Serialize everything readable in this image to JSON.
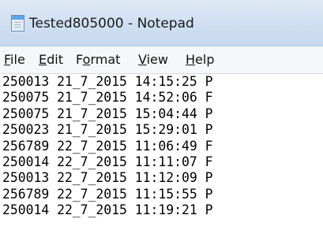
{
  "window": {
    "title": "Tested805000 - Notepad",
    "icon": "notepad-icon"
  },
  "menu": [
    {
      "prefix": "",
      "mnemonic": "F",
      "rest": "ile"
    },
    {
      "prefix": "",
      "mnemonic": "E",
      "rest": "dit"
    },
    {
      "prefix": "F",
      "mnemonic": "o",
      "rest": "rmat"
    },
    {
      "prefix": "",
      "mnemonic": "V",
      "rest": "iew"
    },
    {
      "prefix": "",
      "mnemonic": "H",
      "rest": "elp"
    }
  ],
  "document": {
    "lines": [
      "250013 21_7_2015 14:15:25 P",
      "250075 21_7_2015 14:52:06 F",
      "250075 21_7_2015 15:04:44 P",
      "250023 21_7_2015 15:29:01 P",
      "256789 22_7_2015 11:06:49 F",
      "250014 22_7_2015 11:11:07 F",
      "250013 22_7_2015 11:12:09 P",
      "256789 22_7_2015 11:15:55 P",
      "250014 22_7_2015 11:19:21 P"
    ]
  }
}
